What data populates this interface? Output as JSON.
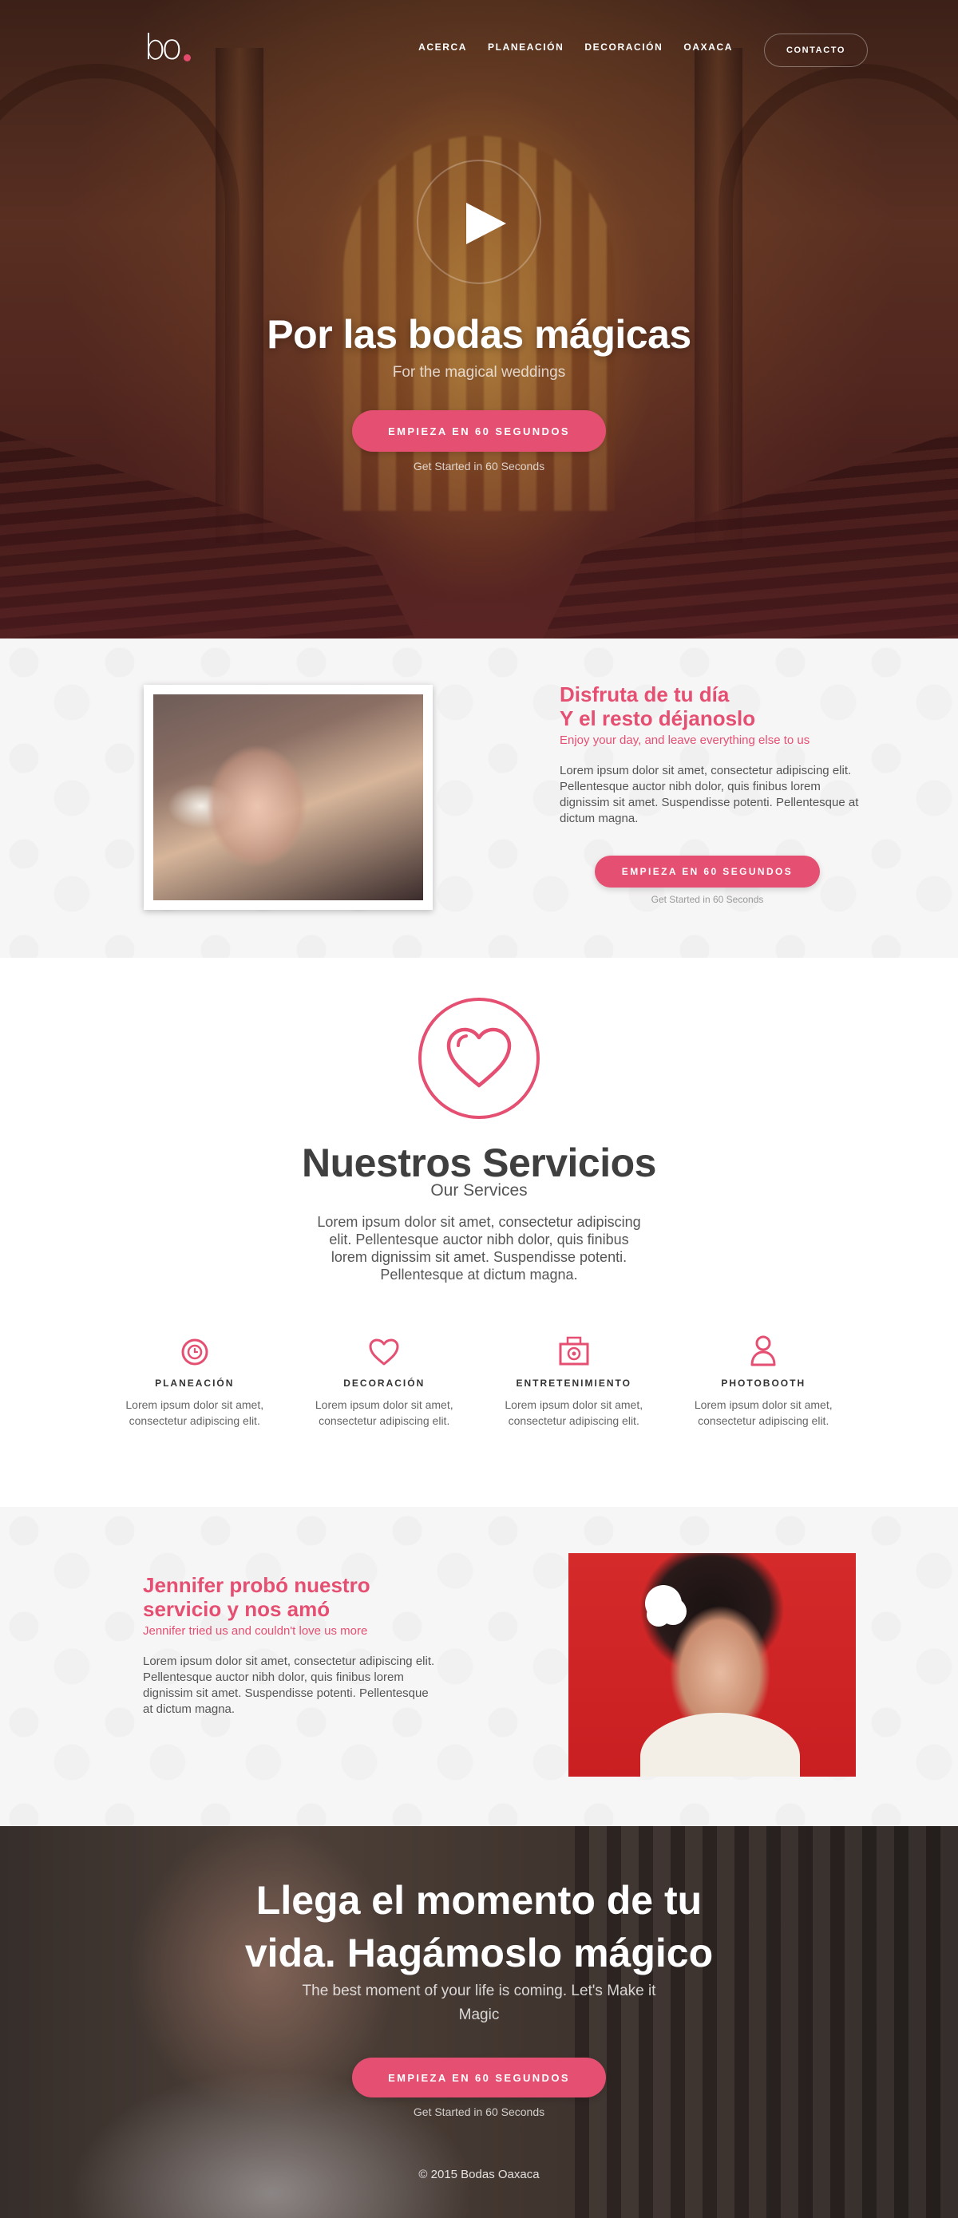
{
  "nav": {
    "logo_text": "bo",
    "links": [
      "Acerca",
      "Planeación",
      "Decoración",
      "Oaxaca"
    ],
    "contact_label": "Contacto"
  },
  "hero": {
    "title": "Por las bodas mágicas",
    "subtitle": "For the magical weddings",
    "cta_label": "Empieza en 60 segundos",
    "cta_note": "Get Started in 60 Seconds"
  },
  "enjoy": {
    "title_line1": "Disfruta de tu día",
    "title_line2": "Y el resto déjanoslo",
    "subtitle": "Enjoy your day, and leave everything else to us",
    "body": "Lorem ipsum dolor sit amet, consectetur adipiscing elit. Pellentesque auctor nibh dolor, quis finibus lorem dignissim sit amet. Suspendisse potenti. Pellentesque at dictum magna.",
    "cta_label": "Empieza en 60 segundos",
    "cta_note": "Get Started in 60 Seconds"
  },
  "services": {
    "title": "Nuestros Servicios",
    "subtitle": "Our Services",
    "description": "Lorem ipsum dolor sit amet, consectetur adipiscing elit. Pellentesque auctor nibh dolor, quis finibus lorem dignissim sit amet. Suspendisse potenti. Pellentesque at dictum magna.",
    "items": [
      {
        "icon": "clock-icon",
        "title": "Planeación",
        "text": "Lorem ipsum dolor sit amet, consectetur adipiscing elit."
      },
      {
        "icon": "heart-icon",
        "title": "Decoración",
        "text": "Lorem ipsum dolor sit amet, consectetur adipiscing elit."
      },
      {
        "icon": "camera-icon",
        "title": "Entretenimiento",
        "text": "Lorem ipsum dolor sit amet, consectetur adipiscing elit."
      },
      {
        "icon": "person-icon",
        "title": "Photobooth",
        "text": "Lorem ipsum dolor sit amet, consectetur adipiscing elit."
      }
    ]
  },
  "testimonial": {
    "title_line1": "Jennifer probó nuestro",
    "title_line2": "servicio y nos amó",
    "subtitle": "Jennifer tried us and couldn't love us more",
    "body": "Lorem ipsum dolor sit amet, consectetur adipiscing elit. Pellentesque auctor nibh dolor, quis finibus lorem dignissim sit amet. Suspendisse potenti. Pellentesque at dictum magna."
  },
  "final": {
    "title": "Llega el momento de tu vida. Hagámoslo mágico",
    "subtitle": "The best moment of your life is coming. Let's Make it Magic",
    "cta_label": "Empieza en 60 segundos",
    "cta_note": "Get Started in 60 Seconds",
    "copyright": "© 2015 Bodas Oaxaca"
  },
  "colors": {
    "accent": "#e54f72",
    "dark_text": "#3f3f3f"
  }
}
